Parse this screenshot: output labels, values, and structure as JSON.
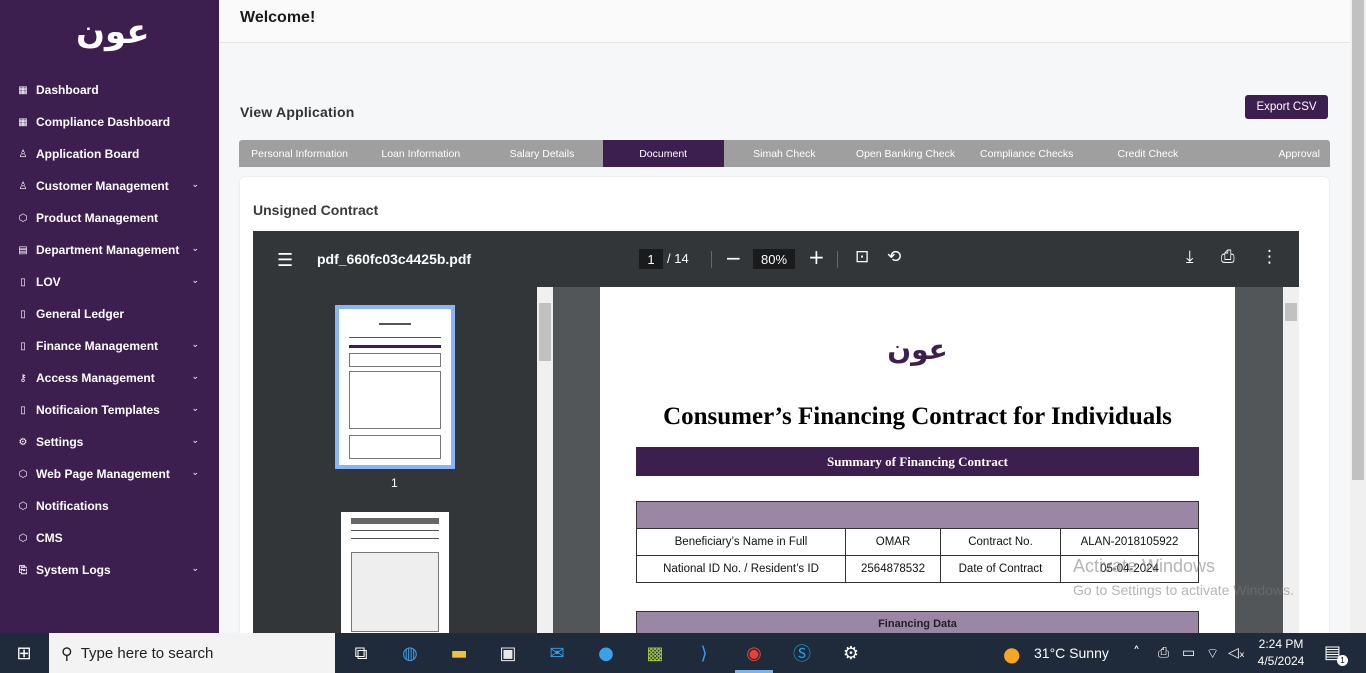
{
  "app": {
    "logo": "عون",
    "welcome": "Welcome!"
  },
  "sidebar": {
    "items": [
      {
        "label": "Dashboard",
        "icon": "grid-icon",
        "chevron": false
      },
      {
        "label": "Compliance Dashboard",
        "icon": "grid-icon",
        "chevron": false
      },
      {
        "label": "Application Board",
        "icon": "user-icon",
        "chevron": false
      },
      {
        "label": "Customer Management",
        "icon": "users-icon",
        "chevron": true
      },
      {
        "label": "Product Management",
        "icon": "cube-icon",
        "chevron": false
      },
      {
        "label": "Department Management",
        "icon": "building-icon",
        "chevron": true
      },
      {
        "label": "LOV",
        "icon": "document-icon",
        "chevron": true
      },
      {
        "label": "General Ledger",
        "icon": "document-icon",
        "chevron": false
      },
      {
        "label": "Finance Management",
        "icon": "document-icon",
        "chevron": true
      },
      {
        "label": "Access Management",
        "icon": "key-icon",
        "chevron": true
      },
      {
        "label": "Notificaion Templates",
        "icon": "document-icon",
        "chevron": true
      },
      {
        "label": "Settings",
        "icon": "gear-icon",
        "chevron": true
      },
      {
        "label": "Web Page Management",
        "icon": "cube-icon",
        "chevron": true
      },
      {
        "label": "Notifications",
        "icon": "cube-icon",
        "chevron": false
      },
      {
        "label": "CMS",
        "icon": "cube-icon",
        "chevron": false
      },
      {
        "label": "System Logs",
        "icon": "log-icon",
        "chevron": true
      }
    ]
  },
  "main": {
    "section_title": "View Application",
    "export_label": "Export CSV",
    "tabs": [
      "Personal Information",
      "Loan Information",
      "Salary Details",
      "Document",
      "Simah Check",
      "Open Banking Check",
      "Compliance Checks",
      "Credit Check",
      "Approval"
    ],
    "active_tab": "Document",
    "card_title": "Unsigned Contract"
  },
  "pdf": {
    "filename": "pdf_660fc03c4425b.pdf",
    "current_page": "1",
    "total_pages": "/ 14",
    "zoom": "80%",
    "thumb_label": "1",
    "doc_logo": "عون",
    "doc_title": "Consumer’s Financing Contract for Individuals",
    "summary_header": "Summary of Financing Contract",
    "rows": [
      [
        "Beneficiary’s Name in Full",
        "OMAR",
        "Contract No.",
        "ALAN-2018105922"
      ],
      [
        "National ID No. / Resident’s ID",
        "2564878532",
        "Date of Contract",
        "05-04-2024"
      ]
    ],
    "financing_header": "Financing Data"
  },
  "watermark": {
    "line1": "Activate Windows",
    "line2": "Go to Settings to activate Windows."
  },
  "taskbar": {
    "search_placeholder": "Type here to search",
    "weather": "31°C  Sunny",
    "time": "2:24 PM",
    "date": "4/5/2024",
    "notification_count": "1"
  },
  "colors": {
    "brand": "#3d1f4f",
    "tab_bg": "#9f9f9f",
    "table_header": "#9b86a6"
  }
}
